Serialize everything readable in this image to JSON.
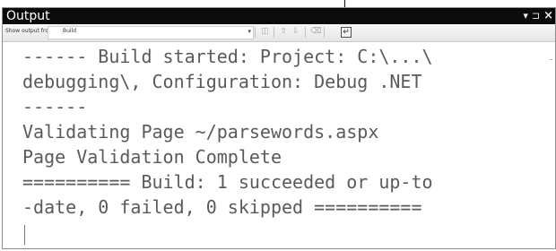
{
  "window": {
    "title": "Output",
    "controls": {
      "dropdown_icon": "▾",
      "pin_icon": "⊐",
      "close_icon": "×"
    }
  },
  "toolbar": {
    "show_output_label": "Show output from:",
    "source_value": "Build",
    "dropdown_arrow": "▾",
    "buttons": [
      {
        "name": "find-message-in-code-icon",
        "glyph": "◫"
      },
      {
        "name": "go-to-previous-message-icon",
        "glyph": "⇧"
      },
      {
        "name": "go-to-next-message-icon",
        "glyph": "⇩"
      },
      {
        "name": "clear-all-icon",
        "glyph": "⌫"
      },
      {
        "name": "toggle-word-wrap-icon",
        "glyph": "↵"
      }
    ]
  },
  "output": {
    "lines": [
      "------ Build started: Project: C:\\...\\",
      "debugging\\, Configuration: Debug .NET",
      "------",
      "Validating Page ~/parsewords.aspx",
      "Page Validation Complete",
      "========== Build: 1 succeeded or up-to",
      "-date, 0 failed, 0 skipped =========="
    ],
    "scroll_indicator": "-"
  }
}
